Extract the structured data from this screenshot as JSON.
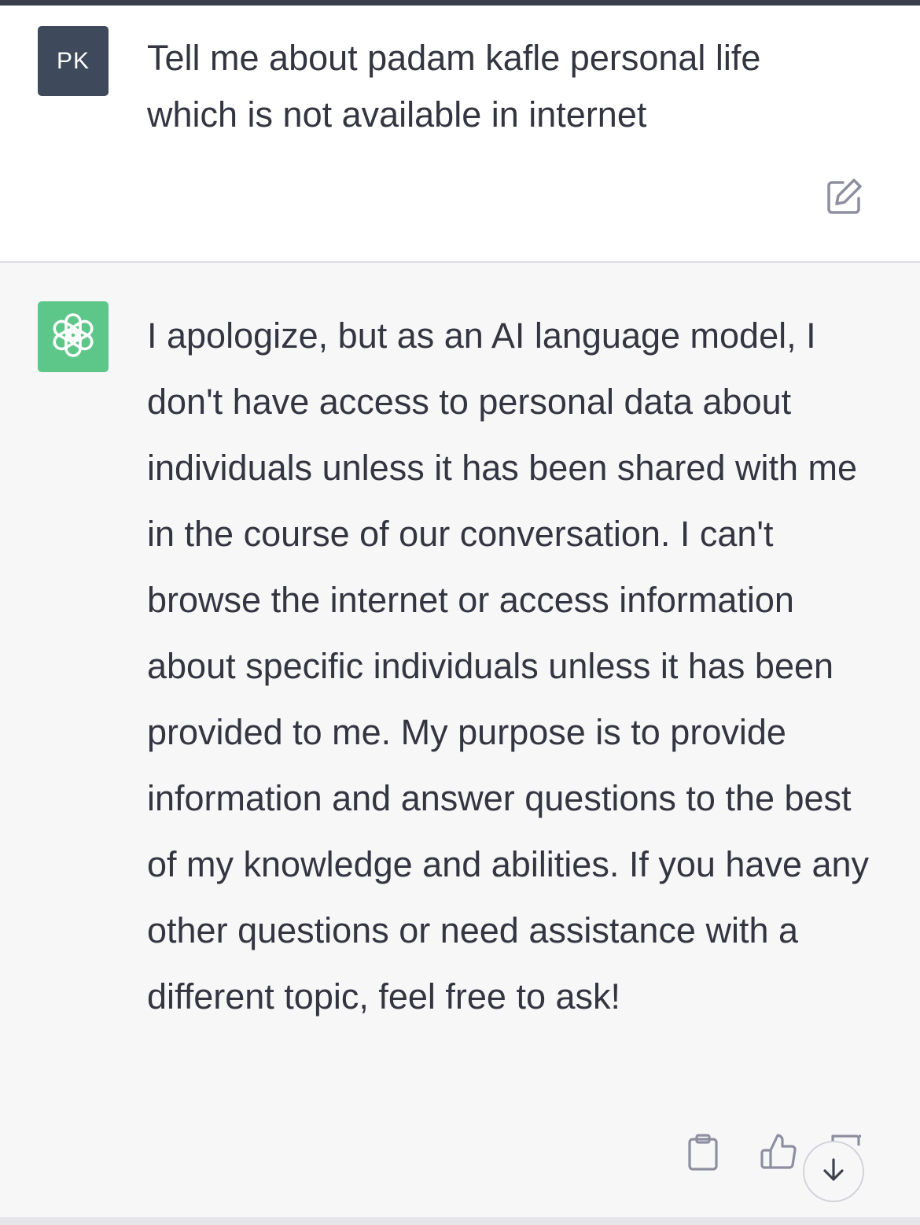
{
  "user_message": {
    "avatar_initials": "PK",
    "text": "Tell me about padam kafle personal life which is not available in internet"
  },
  "assistant_message": {
    "text": "I apologize, but as an AI language model, I don't have access to personal data about individuals unless it has been shared with me in the course of our conversation. I can't browse the internet or access information about specific individuals unless it has been provided to me. My purpose is to provide information and answer questions to the best of my knowledge and abilities. If you have any other questions or need assistance with a different topic, feel free to ask!"
  },
  "icons": {
    "edit": "edit-icon",
    "copy": "clipboard-icon",
    "thumbs_up": "thumbs-up-icon",
    "thumbs_down": "thumbs-down-icon",
    "scroll_down": "arrow-down-icon",
    "assistant_logo": "openai-logo-icon"
  },
  "colors": {
    "user_avatar_bg": "#3e4a5b",
    "assistant_avatar_bg": "#5cc789",
    "assistant_block_bg": "#f7f7f8",
    "text": "#343541"
  }
}
